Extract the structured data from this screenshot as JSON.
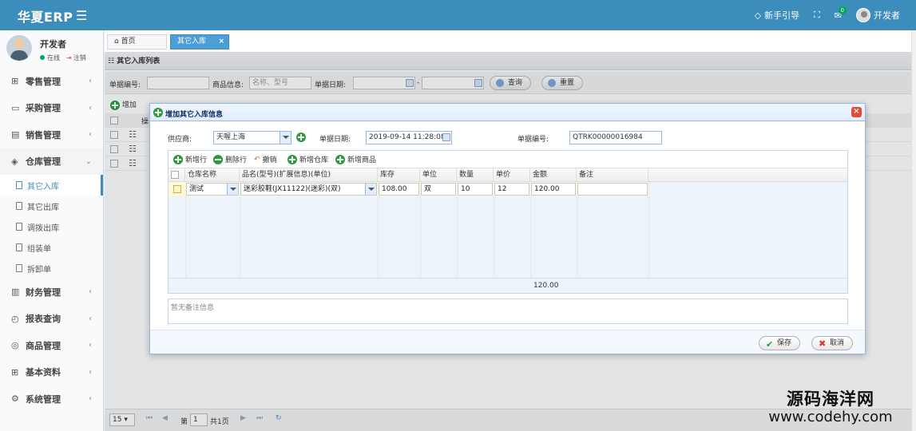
{
  "app": {
    "logo": "华夏ERP"
  },
  "topbar": {
    "guide": "新手引导",
    "notify_count": "0",
    "user": "开发者"
  },
  "user_panel": {
    "name": "开发者",
    "online": "在线",
    "logout": "注销"
  },
  "sidebar": {
    "menus": [
      {
        "icon": "⊞",
        "label": "零售管理",
        "arrow": "‹"
      },
      {
        "icon": "▭",
        "label": "采购管理",
        "arrow": "‹"
      },
      {
        "icon": "▤",
        "label": "销售管理",
        "arrow": "‹"
      },
      {
        "icon": "◈",
        "label": "仓库管理",
        "arrow": "⌄"
      }
    ],
    "submenus": [
      "其它入库",
      "其它出库",
      "调拨出库",
      "组装单",
      "拆卸单"
    ],
    "menus2": [
      {
        "icon": "▥",
        "label": "财务管理",
        "arrow": "‹"
      },
      {
        "icon": "◴",
        "label": "报表查询",
        "arrow": "‹"
      },
      {
        "icon": "◎",
        "label": "商品管理",
        "arrow": "‹"
      },
      {
        "icon": "⊞",
        "label": "基本资料",
        "arrow": "‹"
      },
      {
        "icon": "⚙",
        "label": "系统管理",
        "arrow": "‹"
      }
    ]
  },
  "tabs": {
    "home": "首页",
    "active": "其它入库",
    "close": "×"
  },
  "list": {
    "title": "其它入库列表",
    "search": {
      "bill_no_label": "单据编号:",
      "goods_label": "商品信息:",
      "goods_placeholder": "名称、型号",
      "date_label": "单据日期:",
      "date_sep": "-",
      "query_btn": "查询",
      "reset_btn": "重置"
    },
    "toolbar": {
      "add": "增加",
      "op_col": "操"
    },
    "pager": {
      "size": "15",
      "page_label": "第",
      "page": "1",
      "total": "共1页"
    }
  },
  "dialog": {
    "title": "增加其它入库信息",
    "supplier_label": "供应商:",
    "supplier_value": "天喔上海",
    "date_label": "单据日期:",
    "date_value": "2019-09-14 11:28:08",
    "bill_no_label": "单据编号:",
    "bill_no_value": "QTRK00000016984",
    "toolbar": [
      "新增行",
      "删除行",
      "撤销",
      "新增仓库",
      "新增商品"
    ],
    "columns": [
      "仓库名称",
      "品名(型号)(扩展信息)(单位)",
      "库存",
      "单位",
      "数量",
      "单价",
      "金额",
      "备注"
    ],
    "row": {
      "warehouse": "测试",
      "product": "迷彩胶鞋(JX11122)(迷彩)(双)",
      "stock": "108.00",
      "unit": "双",
      "qty": "10",
      "price": "12",
      "amount": "120.00",
      "remark": ""
    },
    "footer_total": "120.00",
    "remark_placeholder": "暂无备注信息",
    "save_btn": "保存",
    "cancel_btn": "取消"
  },
  "watermark": {
    "line1": "源码海洋网",
    "line2": "www.codehy.com"
  }
}
